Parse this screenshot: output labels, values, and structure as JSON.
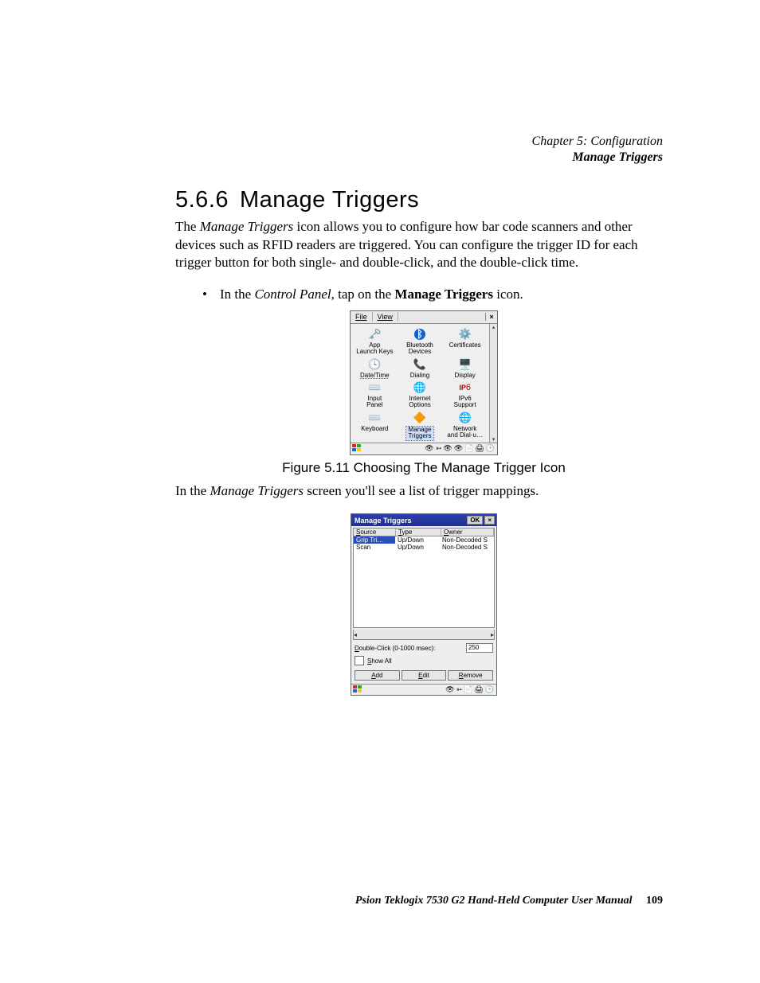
{
  "header": {
    "chapter": "Chapter 5: Configuration",
    "section": "Manage Triggers"
  },
  "heading": {
    "number": "5.6.6",
    "title": "Manage Triggers"
  },
  "para1_pre": "The ",
  "para1_em": "Manage Triggers",
  "para1_post": " icon allows you to configure how bar code scanners and other devices such as RFID readers are triggered. You can configure the trigger ID for each trigger button for both single- and double-click, and the double-click time.",
  "bullet1_pre": "In the ",
  "bullet1_em": "Control Panel",
  "bullet1_mid": ", tap on the ",
  "bullet1_b": "Manage Triggers",
  "bullet1_post": " icon.",
  "control_panel": {
    "menus": {
      "file": "File",
      "view": "View"
    },
    "close": "×",
    "items": [
      {
        "icon": "🗝️",
        "label": "App Launch Keys"
      },
      {
        "icon": "ᛒ",
        "label": "Bluetooth Devices",
        "blue": true
      },
      {
        "icon": "⚙️",
        "label": "Certificates"
      },
      {
        "icon": "🕓",
        "label": "Date/Time",
        "underline": true
      },
      {
        "icon": "📞",
        "label": "Dialing"
      },
      {
        "icon": "🖥️",
        "label": "Display"
      },
      {
        "icon": "⌨️",
        "label": "Input Panel"
      },
      {
        "icon": "🌐",
        "label": "Internet Options"
      },
      {
        "icon": "IP6",
        "label": "IPv6 Support",
        "ip6": true
      },
      {
        "icon": "⌨️",
        "label": "Keyboard"
      },
      {
        "icon": "🔶",
        "label": "Manage Triggers",
        "highlight": true
      },
      {
        "icon": "🌐",
        "label": "Network and Dial-u…"
      }
    ],
    "scroll": {
      "up": "▴",
      "down": "▾"
    },
    "tray": [
      "👁",
      "➳",
      "👁",
      "👁",
      "📄",
      "🖨",
      "🕒"
    ]
  },
  "caption1": "Figure 5.11 Choosing The Manage Trigger Icon",
  "para2_pre": "In the ",
  "para2_em": "Manage Triggers",
  "para2_post": " screen you'll see a list of trigger mappings.",
  "mt": {
    "title": "Manage Triggers",
    "ok": "OK",
    "close": "×",
    "headers": {
      "source": "Source",
      "type": "Type",
      "owner": "Owner"
    },
    "rows": [
      {
        "source": "Grip Tri…",
        "type": "Up/Down",
        "owner": "Non-Decoded S",
        "selected": true
      },
      {
        "source": "Scan",
        "type": "Up/Down",
        "owner": "Non-Decoded S"
      }
    ],
    "hscroll": {
      "left": "◂",
      "right": "▸"
    },
    "dbl_label_pre": "D",
    "dbl_label_post": "ouble-Click (0-1000 msec):",
    "dbl_value": "250",
    "showall_pre": "S",
    "showall_post": "how All",
    "buttons": {
      "add_u": "A",
      "add_rest": "dd",
      "edit_u": "E",
      "edit_rest": "dit",
      "remove_u": "R",
      "remove_rest": "emove"
    },
    "tray": [
      "👁",
      "➳",
      "📄",
      "🖨",
      "🕒"
    ]
  },
  "footer": {
    "text": "Psion Teklogix 7530 G2 Hand-Held Computer User Manual",
    "page": "109"
  }
}
